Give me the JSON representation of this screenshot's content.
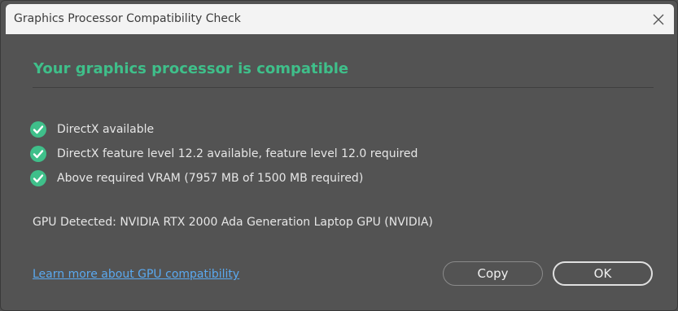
{
  "window": {
    "title": "Graphics Processor Compatibility Check"
  },
  "main": {
    "heading": "Your graphics processor is compatible",
    "checks": [
      {
        "label": "DirectX available",
        "status": "pass"
      },
      {
        "label": "DirectX feature level 12.2 available, feature level 12.0 required",
        "status": "pass"
      },
      {
        "label": "Above required VRAM (7957 MB of 1500 MB required)",
        "status": "pass"
      }
    ],
    "gpu_detected": "GPU Detected: NVIDIA RTX 2000 Ada Generation Laptop GPU (NVIDIA)"
  },
  "footer": {
    "link_label": "Learn more about GPU compatibility",
    "copy_label": "Copy",
    "ok_label": "OK"
  },
  "icons": {
    "close": "close-icon",
    "check": "check-circle-icon"
  },
  "colors": {
    "accent_green": "#3fbf8a",
    "link_blue": "#5aa9f0",
    "background": "#535353"
  }
}
